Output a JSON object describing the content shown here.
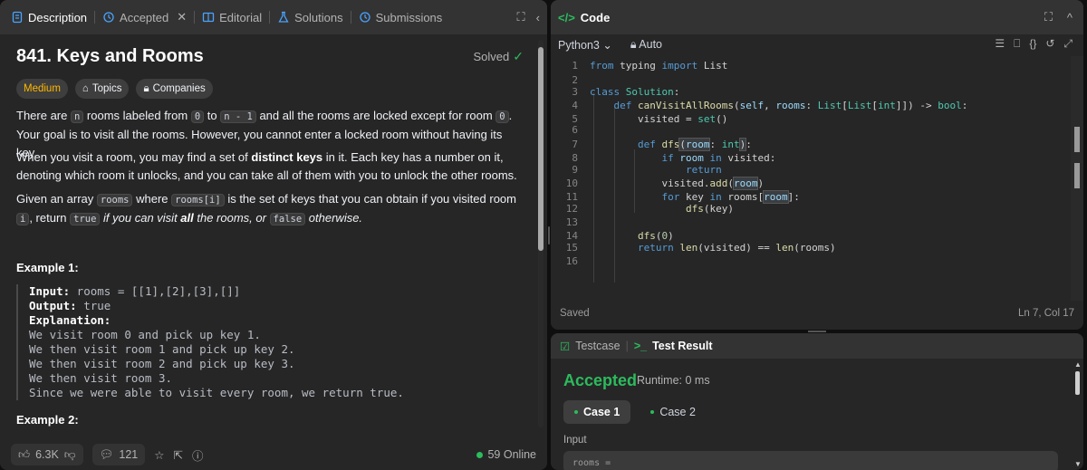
{
  "tabs": {
    "description": "Description",
    "accepted": "Accepted",
    "editorial": "Editorial",
    "solutions": "Solutions",
    "submissions": "Submissions"
  },
  "problem": {
    "title": "841. Keys and Rooms",
    "status": "Solved",
    "difficulty": "Medium",
    "topics_label": "Topics",
    "companies_label": "Companies",
    "p1_a": "There are ",
    "p1_n": "n",
    "p1_b": " rooms labeled from ",
    "p1_0": "0",
    "p1_c": " to ",
    "p1_n1": "n - 1",
    "p1_d": " and all the rooms are locked except for room ",
    "p1_0b": "0",
    "p1_e": ". Your goal is to visit all the rooms. However, you cannot enter a locked room without having its key.",
    "p2_a": "When you visit a room, you may find a set of ",
    "p2_bold": "distinct keys",
    "p2_b": " in it. Each key has a number on it, denoting which room it unlocks, and you can take all of them with you to unlock the other rooms.",
    "p3_a": "Given an array ",
    "p3_rooms": "rooms",
    "p3_b": " where ",
    "p3_roomsi": "rooms[i]",
    "p3_c": " is the set of keys that you can obtain if you visited room ",
    "p3_i": "i",
    "p3_d": ", return ",
    "p3_true": "true",
    "p3_e": " if you can visit ",
    "p3_all": "all",
    "p3_f": " the rooms, or ",
    "p3_false": "false",
    "p3_g": " otherwise.",
    "example1_title": "Example 1:",
    "example1": {
      "input_label": "Input:",
      "input_value": " rooms = [[1],[2],[3],[]]",
      "output_label": "Output:",
      "output_value": " true",
      "explanation_label": "Explanation:",
      "lines": [
        "We visit room 0 and pick up key 1.",
        "We then visit room 1 and pick up key 2.",
        "We then visit room 2 and pick up key 3.",
        "We then visit room 3.",
        "Since we were able to visit every room, we return true."
      ]
    },
    "example2_title": "Example 2:"
  },
  "footer": {
    "likes": "6.3K",
    "comments": "121",
    "online": "59 Online"
  },
  "code_panel": {
    "title": "Code",
    "language": "Python3",
    "mode": "Auto",
    "saved": "Saved",
    "cursor": "Ln 7, Col 17",
    "line_numbers": [
      "1",
      "2",
      "3",
      "4",
      "5",
      "6",
      "7",
      "8",
      "9",
      "10",
      "11",
      "12",
      "13",
      "14",
      "15",
      "16"
    ]
  },
  "test_panel": {
    "testcase_tab": "Testcase",
    "result_tab": "Test Result",
    "verdict": "Accepted",
    "runtime": "Runtime: 0 ms",
    "case1": "Case 1",
    "case2": "Case 2",
    "input_label": "Input",
    "input_preview": "rooms ="
  },
  "colors": {
    "accent_green": "#2cbb5d",
    "difficulty_medium": "#ffb800",
    "panel_bg": "#262626",
    "header_bg": "#333333"
  }
}
